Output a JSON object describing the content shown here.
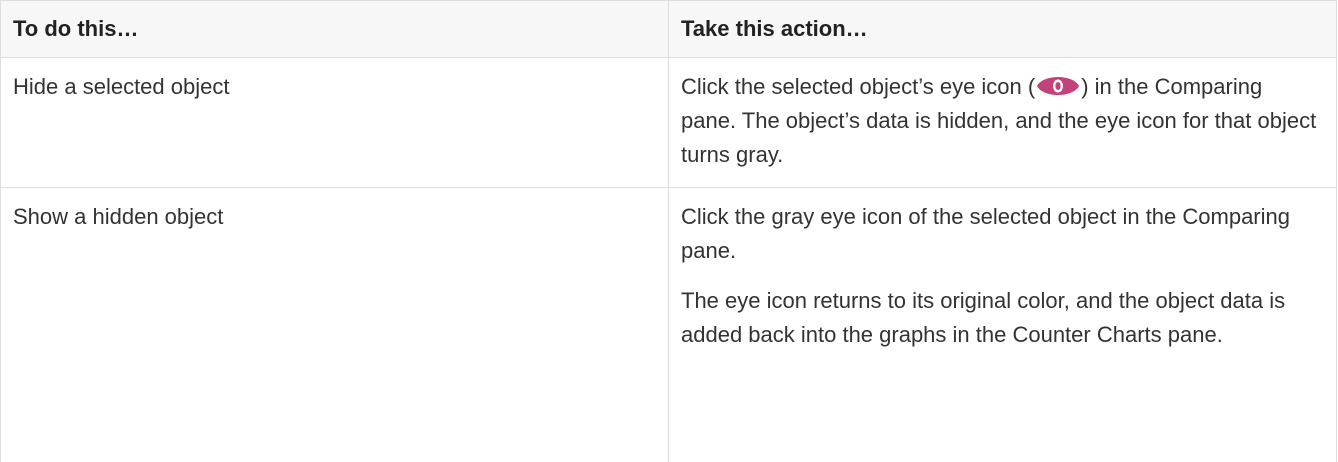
{
  "table": {
    "headers": [
      "To do this…",
      "Take this action…"
    ],
    "rows": [
      {
        "task": "Hide a selected object",
        "action_before_icon": "Click the selected object’s eye icon (",
        "action_icon": "eye-icon",
        "action_after_icon": ") in the Comparing pane. The object’s data is hidden, and the eye icon for that object turns gray."
      },
      {
        "task": "Show a hidden object",
        "action_paragraphs": [
          "Click the gray eye icon of the selected object in the Comparing pane.",
          "The eye icon returns to its original color, and the object data is added back into the graphs in the Counter Charts pane."
        ]
      }
    ]
  },
  "colors": {
    "eye_icon": "#c2427a",
    "eye_icon_center": "#ffffff",
    "header_bg": "#f7f7f7",
    "border": "#dedede"
  }
}
